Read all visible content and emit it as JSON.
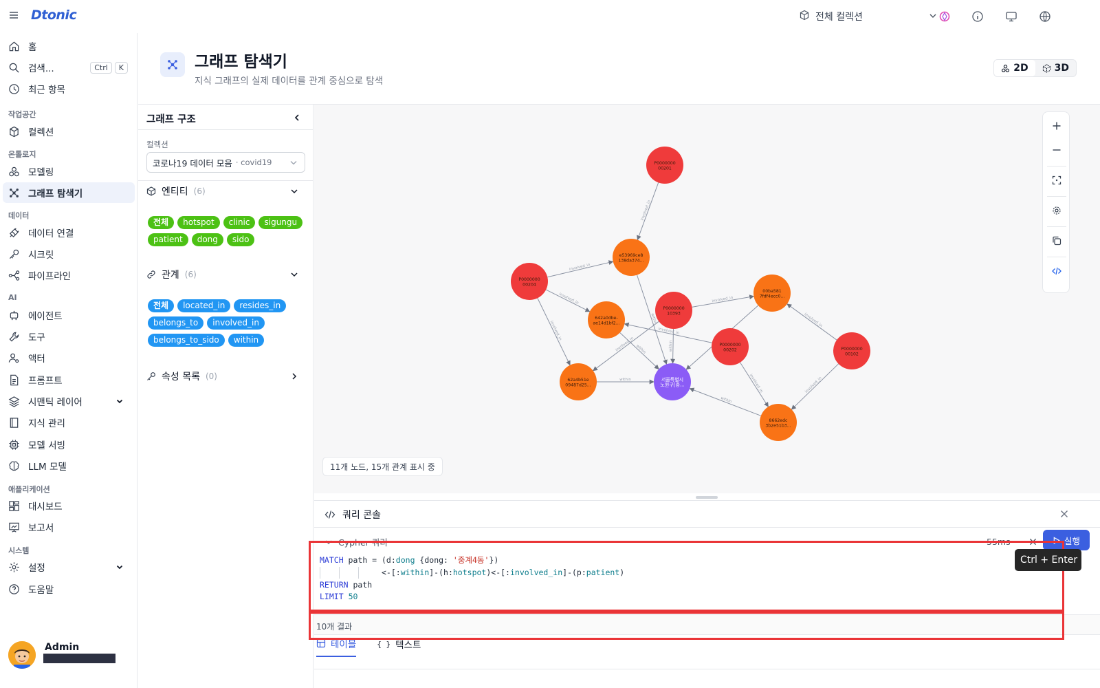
{
  "app": {
    "logo": "Dtonic"
  },
  "topbar": {
    "collection_label": "전체 컬렉션",
    "icons": [
      "menu-icon",
      "box-icon",
      "chevron-down-icon",
      "brand-icon",
      "info-icon",
      "monitor-icon",
      "globe-icon"
    ]
  },
  "sidebar": {
    "home": "홈",
    "search": "검색...",
    "search_kbd": [
      "Ctrl",
      "K"
    ],
    "recent": "최근 항목",
    "sections": {
      "workspace": "작업공간",
      "ontology": "온톨로지",
      "data": "데이터",
      "ai": "AI",
      "applications": "애플리케이션",
      "system": "시스템"
    },
    "items": {
      "collections": "컬렉션",
      "modeling": "모델링",
      "graph_explorer": "그래프 탐색기",
      "data_connection": "데이터 연결",
      "secrets": "시크릿",
      "pipeline": "파이프라인",
      "agents": "에이전트",
      "tools": "도구",
      "actors": "액터",
      "prompts": "프롬프트",
      "semantic_layer": "시맨틱 레이어",
      "knowledge": "지식 관리",
      "model_serving": "모델 서빙",
      "llm_models": "LLM 모델",
      "dashboard": "대시보드",
      "reports": "보고서",
      "settings": "설정",
      "help": "도움말"
    },
    "user": {
      "name": "Admin"
    }
  },
  "header": {
    "title": "그래프 탐색기",
    "subtitle": "지식 그래프의 실제 데이터를 관계 중심으로 탐색",
    "view_2d": "2D",
    "view_3d": "3D"
  },
  "panel": {
    "title": "그래프 구조",
    "collection_label": "컬렉션",
    "collection_value": "코로나19 데이터 모음",
    "collection_id": "· covid19",
    "entities_title": "엔티티",
    "entities_count": "(6)",
    "entities": [
      "전체",
      "hotspot",
      "clinic",
      "sigungu",
      "patient",
      "dong",
      "sido"
    ],
    "relations_title": "관계",
    "relations_count": "(6)",
    "relations": [
      "전체",
      "located_in",
      "resides_in",
      "belongs_to",
      "involved_in",
      "belongs_to_sido",
      "within"
    ],
    "properties_title": "속성 목록",
    "properties_count": "(0)"
  },
  "graph": {
    "status": "11개 노드, 15개 관계 표시 중",
    "colors": {
      "patient": "#ef3b3b",
      "hotspot": "#f97316",
      "dong": "#8b5cf6",
      "edge": "#8b93a3"
    },
    "nodes": [
      {
        "id": "n1",
        "label1": "P0000000",
        "label2": "00201",
        "type": "patient"
      },
      {
        "id": "n2",
        "label1": "e53969ce8",
        "label2": "138da374...",
        "type": "hotspot"
      },
      {
        "id": "n3",
        "label1": "P0000000",
        "label2": "00204",
        "type": "patient"
      },
      {
        "id": "n4",
        "label1": "642a0dbe-",
        "label2": "ae14d1bf2...",
        "type": "hotspot"
      },
      {
        "id": "n5",
        "label1": "P0000000",
        "label2": "10393",
        "type": "patient"
      },
      {
        "id": "n6",
        "label1": "00ba581",
        "label2": "7fdf4ecc0...",
        "type": "hotspot"
      },
      {
        "id": "n7",
        "label1": "P0000000",
        "label2": "00202",
        "type": "patient"
      },
      {
        "id": "n8",
        "label1": "P0000000",
        "label2": "00102",
        "type": "patient"
      },
      {
        "id": "n9",
        "label1": "62a4b51e",
        "label2": "09487d25...",
        "type": "hotspot"
      },
      {
        "id": "n10",
        "label1": "서울특별시",
        "label2": "노원구[중...",
        "type": "dong"
      },
      {
        "id": "n11",
        "label1": "8662edc",
        "label2": "3b2e51b3...",
        "type": "hotspot"
      }
    ],
    "edges": [
      {
        "from": "n1",
        "to": "n2",
        "label": "involved_in"
      },
      {
        "from": "n3",
        "to": "n2",
        "label": "involved_in"
      },
      {
        "from": "n3",
        "to": "n4",
        "label": "involved_in"
      },
      {
        "from": "n3",
        "to": "n9",
        "label": "involved_in"
      },
      {
        "from": "n2",
        "to": "n10",
        "label": "within"
      },
      {
        "from": "n4",
        "to": "n10",
        "label": "within"
      },
      {
        "from": "n5",
        "to": "n6",
        "label": "involved_in"
      },
      {
        "from": "n5",
        "to": "n9",
        "label": "involved_in"
      },
      {
        "from": "n5",
        "to": "n10",
        "label": "within"
      },
      {
        "from": "n7",
        "to": "n4",
        "label": "involved_in"
      },
      {
        "from": "n7",
        "to": "n11",
        "label": "involved_in"
      },
      {
        "from": "n6",
        "to": "n10",
        "label": "within"
      },
      {
        "from": "n8",
        "to": "n6",
        "label": "involved_in"
      },
      {
        "from": "n8",
        "to": "n11",
        "label": "involved_in"
      },
      {
        "from": "n9",
        "to": "n10",
        "label": "within"
      },
      {
        "from": "n11",
        "to": "n10",
        "label": "within"
      }
    ]
  },
  "console": {
    "title": "쿼리 콘솔",
    "cypher_label": "Cypher 쿼리",
    "time": "55ms",
    "run_label": "실행",
    "tooltip": "Ctrl + Enter",
    "query": {
      "l1_kw": "MATCH",
      "l1_var": " path = (d:",
      "l1_label": "dong",
      "l1_prop": " {dong: ",
      "l1_str": "'중계4동'",
      "l1_end": "})",
      "l2_a": "<-[:",
      "l2_rel1": "within",
      "l2_b": "]-(h:",
      "l2_lab2": "hotspot",
      "l2_c": ")<-[:",
      "l2_rel2": "involved_in",
      "l2_d": "]-(p:",
      "l2_lab3": "patient",
      "l2_e": ")",
      "l3_kw": "RETURN",
      "l3_rest": " path",
      "l4_kw": "LIMIT",
      "l4_num": "50"
    },
    "results": "10개 결과",
    "tab_table": "테이블",
    "tab_text": "텍스트"
  }
}
